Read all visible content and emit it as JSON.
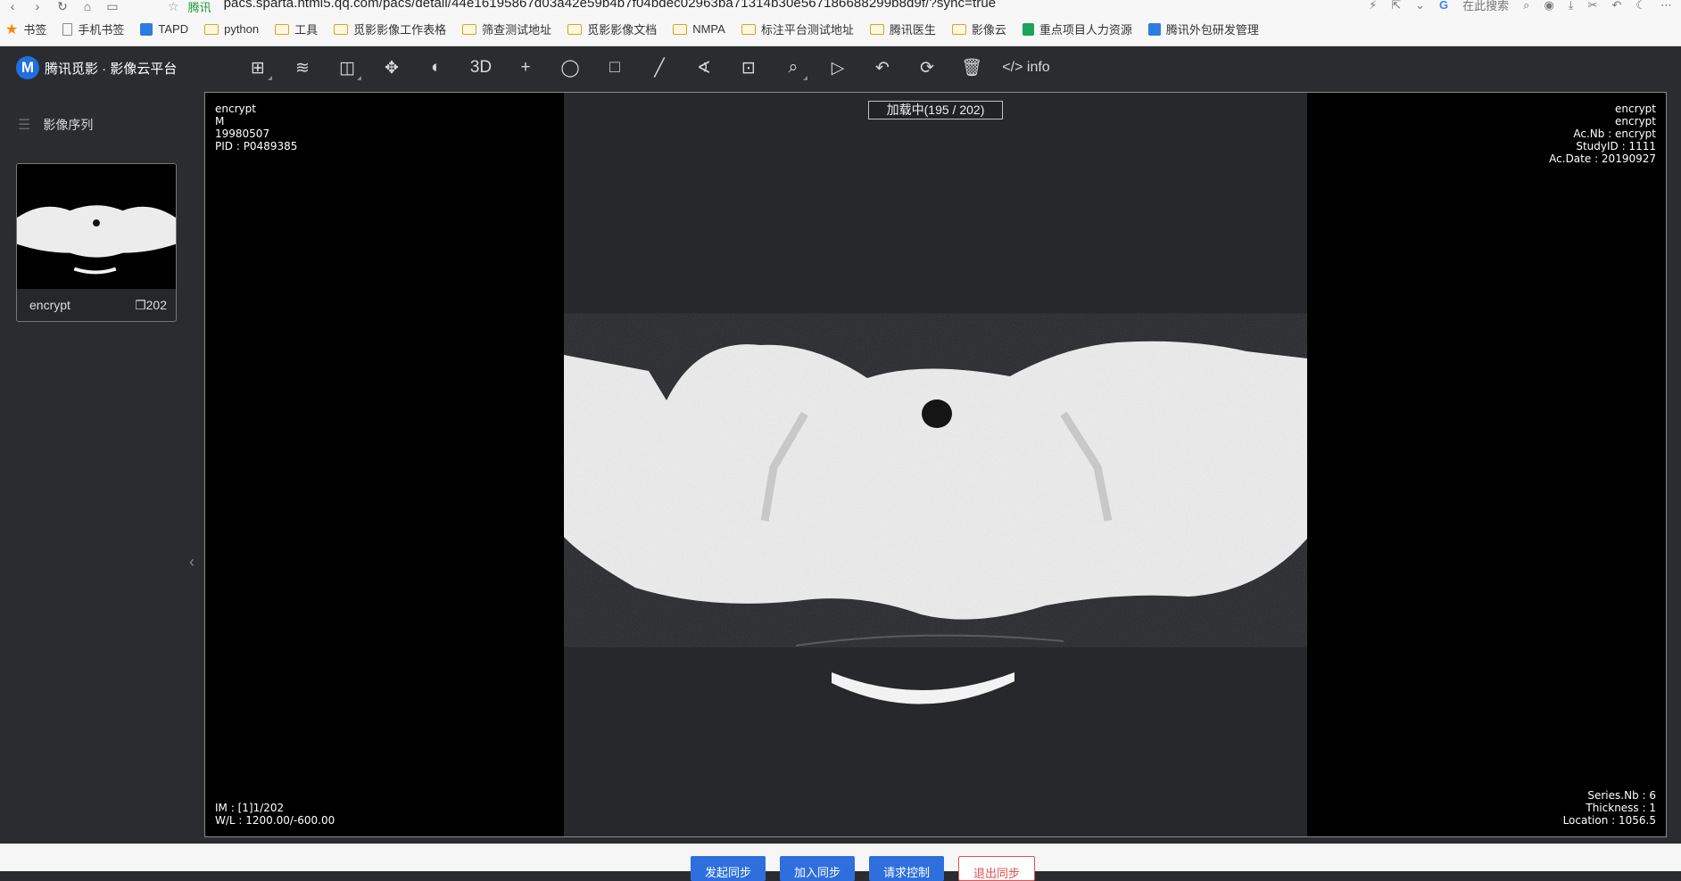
{
  "browser": {
    "site_label": "腾讯",
    "url": "pacs.sparta.html5.qq.com/pacs/detail/44e16195867d03a42e59b4b7f04bdec02963ba71314b30e567186688299b8d9f/?sync=true",
    "search_label": "在此搜索",
    "bookmarks": [
      {
        "label": "书签",
        "icon": "star-icon"
      },
      {
        "label": "手机书签",
        "icon": "page-icon"
      },
      {
        "label": "TAPD",
        "icon": "tapd-icon"
      },
      {
        "label": "python",
        "icon": "folder-icon"
      },
      {
        "label": "工具",
        "icon": "folder-icon"
      },
      {
        "label": "觅影影像工作表格",
        "icon": "folder-icon"
      },
      {
        "label": "筛查测试地址",
        "icon": "folder-icon"
      },
      {
        "label": "觅影影像文档",
        "icon": "folder-icon"
      },
      {
        "label": "NMPA",
        "icon": "folder-icon"
      },
      {
        "label": "标注平台测试地址",
        "icon": "folder-icon"
      },
      {
        "label": "腾讯医生",
        "icon": "folder-icon"
      },
      {
        "label": "影像云",
        "icon": "folder-icon"
      },
      {
        "label": "重点项目人力资源",
        "icon": "sheet-icon"
      },
      {
        "label": "腾讯外包研发管理",
        "icon": "tapd-icon"
      }
    ]
  },
  "app": {
    "logo_mark": "M",
    "title": "腾讯觅影 · 影像云平台",
    "toolbar": {
      "three_d": "3D",
      "info": "info"
    }
  },
  "sidebar": {
    "heading": "影像序列",
    "series": {
      "name": "encrypt",
      "count": "202"
    }
  },
  "viewer": {
    "loading": "加载中(195 / 202)",
    "top_left": [
      "encrypt",
      "M",
      "19980507",
      "PID : P0489385"
    ],
    "top_right": [
      "encrypt",
      "encrypt",
      "Ac.Nb : encrypt",
      "StudyID : 1111",
      "Ac.Date : 20190927"
    ],
    "bottom_left": [
      "IM : [1]1/202",
      "W/L : 1200.00/-600.00"
    ],
    "bottom_right": [
      "Series.Nb : 6",
      "Thickness : 1",
      "Location : 1056.5"
    ]
  },
  "sync": {
    "start": "发起同步",
    "join": "加入同步",
    "request": "请求控制",
    "exit": "退出同步"
  }
}
